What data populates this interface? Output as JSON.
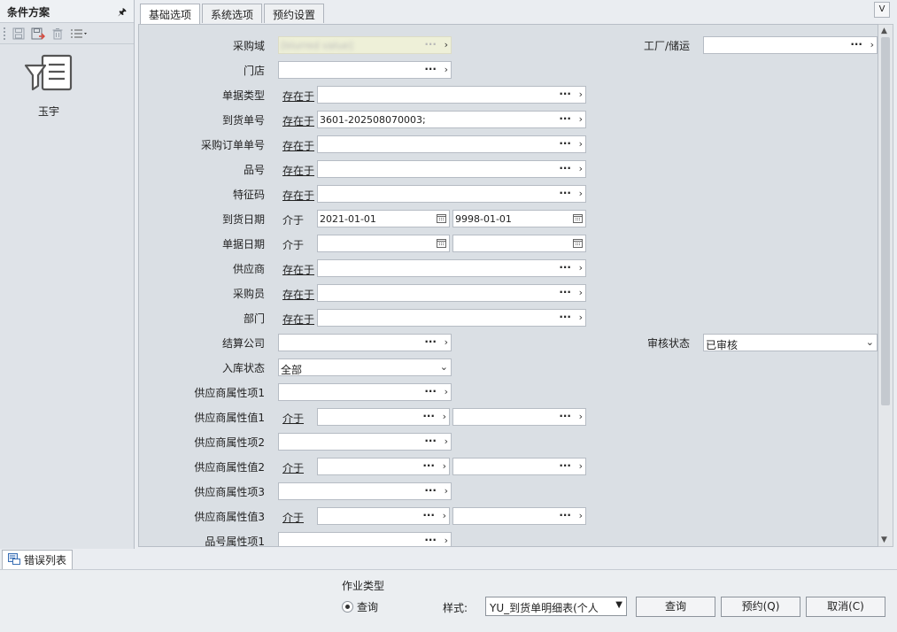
{
  "left_panel": {
    "title": "条件方案",
    "pin": "ᵽ",
    "scheme_name": "玉宇"
  },
  "tabs": [
    {
      "label": "基础选项",
      "active": true
    },
    {
      "label": "系统选项",
      "active": false
    },
    {
      "label": "预约设置",
      "active": false
    }
  ],
  "collapse_label": "V",
  "form": {
    "purchase_domain": {
      "label": "采购域",
      "value": "[blurred value]"
    },
    "plant": {
      "label": "工厂/储运",
      "value": ""
    },
    "store": {
      "label": "门店",
      "value": ""
    },
    "doc_type": {
      "label": "单据类型",
      "op": "存在于",
      "value": ""
    },
    "arrival_no": {
      "label": "到货单号",
      "op": "存在于",
      "value": "3601-202508070003;"
    },
    "po_no": {
      "label": "采购订单单号",
      "op": "存在于",
      "value": ""
    },
    "item_no": {
      "label": "品号",
      "op": "存在于",
      "value": ""
    },
    "feature_code": {
      "label": "特征码",
      "op": "存在于",
      "value": ""
    },
    "arrival_date": {
      "label": "到货日期",
      "op": "介于",
      "from": "2021-01-01",
      "to": "9998-01-01"
    },
    "doc_date": {
      "label": "单据日期",
      "op": "介于",
      "from": "",
      "to": ""
    },
    "supplier": {
      "label": "供应商",
      "op": "存在于",
      "value": ""
    },
    "buyer": {
      "label": "采购员",
      "op": "存在于",
      "value": ""
    },
    "dept": {
      "label": "部门",
      "op": "存在于",
      "value": ""
    },
    "settle_company": {
      "label": "结算公司",
      "value": ""
    },
    "audit_status": {
      "label": "审核状态",
      "value": "已审核"
    },
    "stock_status": {
      "label": "入库状态",
      "value": "全部"
    },
    "supp_attr_item1": {
      "label": "供应商属性项1",
      "value": ""
    },
    "supp_attr_val1": {
      "label": "供应商属性值1",
      "op": "介于",
      "from": "",
      "to": ""
    },
    "supp_attr_item2": {
      "label": "供应商属性项2",
      "value": ""
    },
    "supp_attr_val2": {
      "label": "供应商属性值2",
      "op": "介于",
      "from": "",
      "to": ""
    },
    "supp_attr_item3": {
      "label": "供应商属性项3",
      "value": ""
    },
    "supp_attr_val3": {
      "label": "供应商属性值3",
      "op": "介于",
      "from": "",
      "to": ""
    },
    "item_attr_item1": {
      "label": "品号属性项1",
      "value": ""
    }
  },
  "error_tab": "错误列表",
  "bottom": {
    "job_type_label": "作业类型",
    "job_type_option": "查询",
    "style_label": "样式:",
    "style_value": "YU_到货单明细表(个人",
    "query_button": "查询",
    "reserve_button": "预约(Q)",
    "cancel_button": "取消(C)"
  }
}
